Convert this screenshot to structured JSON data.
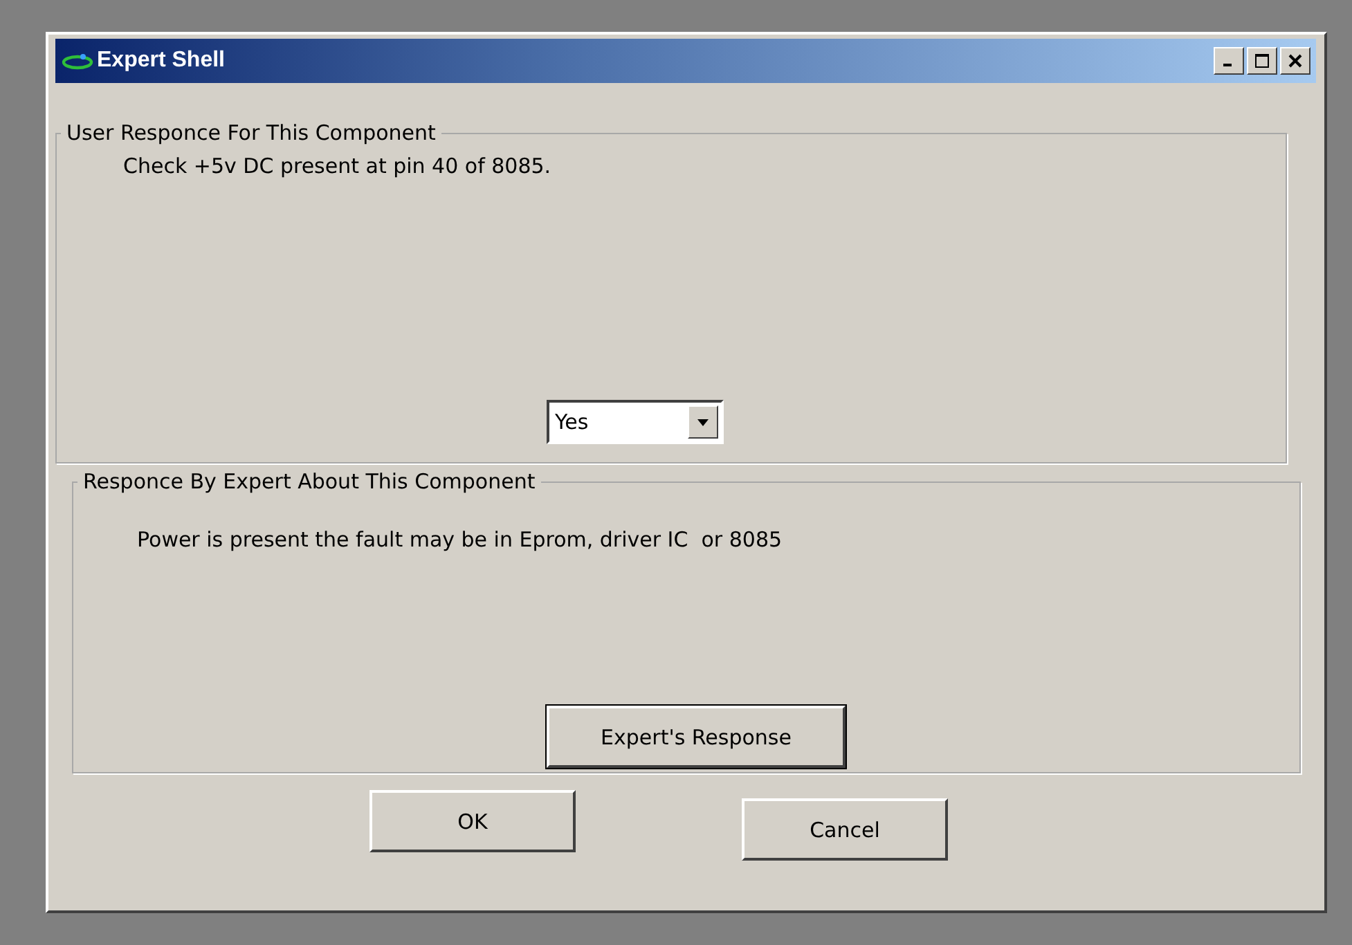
{
  "window": {
    "title": "Expert Shell"
  },
  "user_group": {
    "legend": "User Responce For This Component",
    "question": "Check +5v DC present at pin 40 of 8085.",
    "answer": {
      "value": "Yes"
    }
  },
  "expert_group": {
    "legend": "Responce By Expert About This Component",
    "response": "Power is present the fault may be in Eprom, driver IC  or 8085",
    "button": "Expert's Response"
  },
  "buttons": [
    "OK",
    "Cancel"
  ]
}
